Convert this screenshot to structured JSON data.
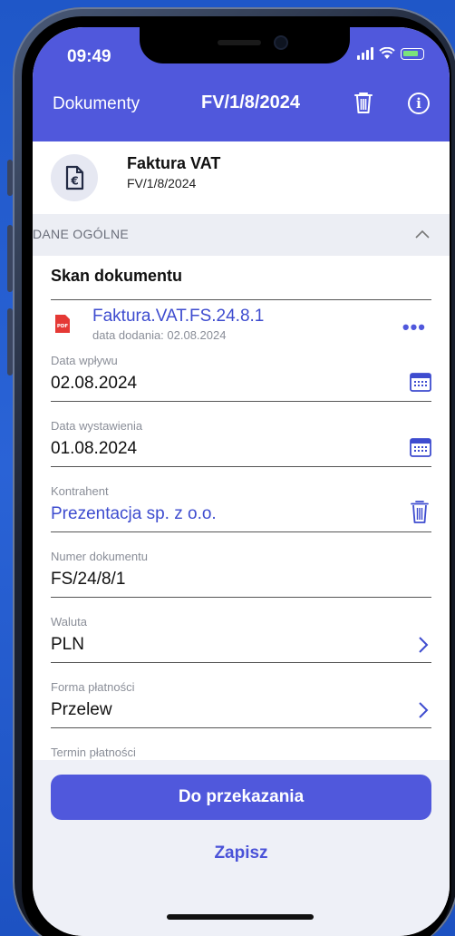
{
  "status_bar": {
    "time": "09:49"
  },
  "nav": {
    "back_label": "Dokumenty",
    "title": "FV/1/8/2024",
    "trash_icon": "trash-icon",
    "info_icon": "info-icon"
  },
  "document": {
    "icon": "invoice-euro-icon",
    "type": "Faktura VAT",
    "number": "FV/1/8/2024"
  },
  "section": {
    "label": "DANE OGÓLNE",
    "chevron_icon": "chevron-up-icon"
  },
  "scan": {
    "title": "Skan dokumentu",
    "file_name": "Faktura.VAT.FS.24.8.1",
    "file_date": "data dodania: 02.08.2024",
    "more": "•••"
  },
  "fields": {
    "received": {
      "label": "Data wpływu",
      "value": "02.08.2024"
    },
    "issued": {
      "label": "Data wystawienia",
      "value": "01.08.2024"
    },
    "contractor": {
      "label": "Kontrahent",
      "value": "Prezentacja sp. z o.o."
    },
    "doc_number": {
      "label": "Numer dokumentu",
      "value": "FS/24/8/1"
    },
    "currency": {
      "label": "Waluta",
      "value": "PLN"
    },
    "payment": {
      "label": "Forma płatności",
      "value": "Przelew"
    },
    "due": {
      "label": "Termin płatności"
    }
  },
  "actions": {
    "primary": "Do przekazania",
    "secondary": "Zapisz"
  },
  "colors": {
    "accent": "#5058dc",
    "link": "#3e4ccf",
    "background": "#2a63d6"
  }
}
